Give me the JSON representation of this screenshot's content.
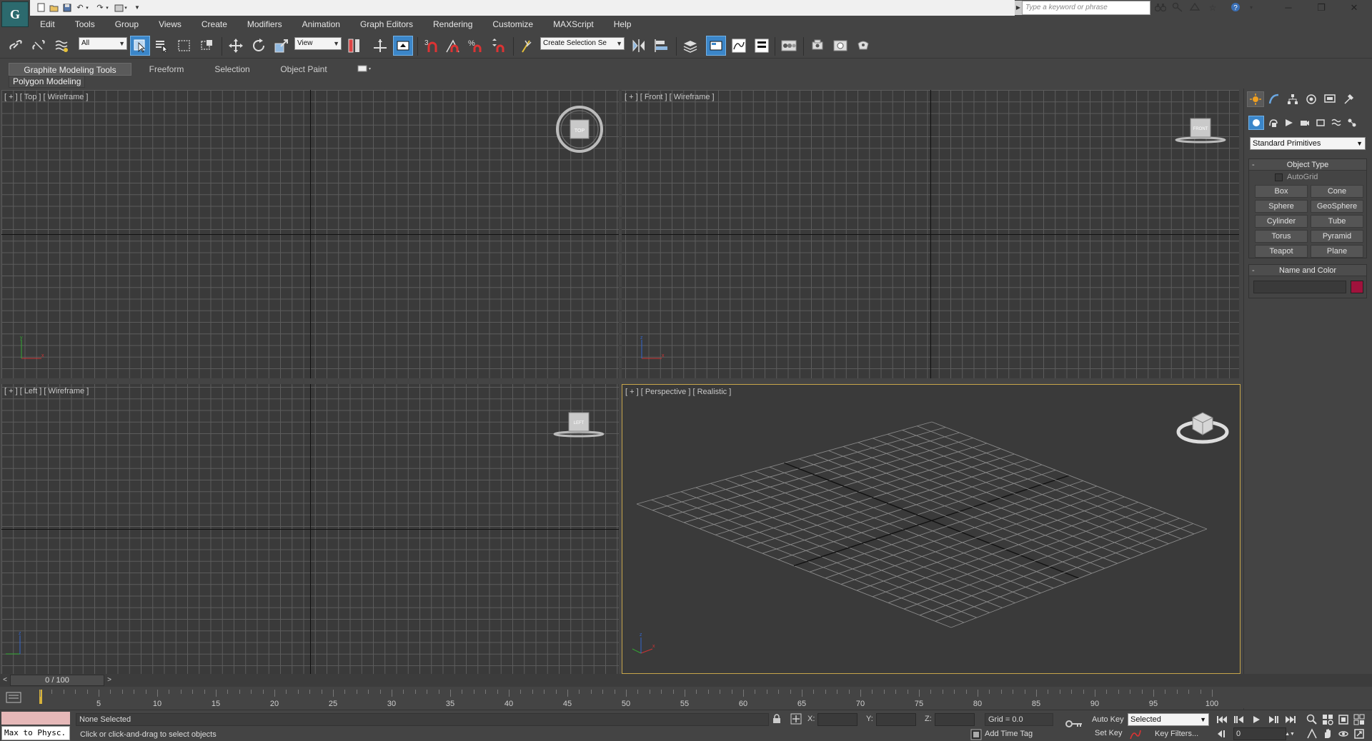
{
  "app": {
    "logo_text": "G",
    "search_placeholder": "Type a keyword or phrase"
  },
  "menu": [
    "Edit",
    "Tools",
    "Group",
    "Views",
    "Create",
    "Modifiers",
    "Animation",
    "Graph Editors",
    "Rendering",
    "Customize",
    "MAXScript",
    "Help"
  ],
  "toolbar": {
    "filter_value": "All",
    "ref_coord_value": "View",
    "selection_set_value": "Create Selection Se",
    "snap_label": "3"
  },
  "ribbon": {
    "tabs": [
      "Graphite Modeling Tools",
      "Freeform",
      "Selection",
      "Object Paint"
    ],
    "sub_label": "Polygon Modeling"
  },
  "viewports": {
    "top": "[ + ] [ Top ] [ Wireframe ]",
    "front": "[ + ] [ Front ] [ Wireframe ]",
    "left": "[ + ] [ Left ] [ Wireframe ]",
    "perspective": "[ + ] [ Perspective ] [ Realistic ]",
    "cube_top": "TOP",
    "cube_front": "FRONT",
    "cube_left": "LEFT"
  },
  "command_panel": {
    "primitives_value": "Standard Primitives",
    "object_type_title": "Object Type",
    "autogrid_label": "AutoGrid",
    "buttons": [
      "Box",
      "Cone",
      "Sphere",
      "GeoSphere",
      "Cylinder",
      "Tube",
      "Torus",
      "Pyramid",
      "Teapot",
      "Plane"
    ],
    "name_color_title": "Name and Color",
    "object_color": "#a0123c"
  },
  "timeline": {
    "slider_label": "0 / 100",
    "ticks": [
      "5",
      "10",
      "15",
      "20",
      "25",
      "30",
      "35",
      "40",
      "45",
      "50",
      "55",
      "60",
      "65",
      "70",
      "75",
      "80",
      "85",
      "90",
      "95",
      "100"
    ]
  },
  "status": {
    "maxscript_text": "Max to Physc.",
    "selection": "None Selected",
    "prompt": "Click or click-and-drag to select objects",
    "x_label": "X:",
    "y_label": "Y:",
    "z_label": "Z:",
    "grid": "Grid = 0.0",
    "add_time_tag": "Add Time Tag",
    "auto_key": "Auto Key",
    "set_key": "Set Key",
    "auto_key_value": "Selected",
    "key_filters": "Key Filters...",
    "frame_value": "0"
  },
  "colors": {
    "accent": "#3b86c9",
    "active_viewport": "#c7a54a"
  }
}
